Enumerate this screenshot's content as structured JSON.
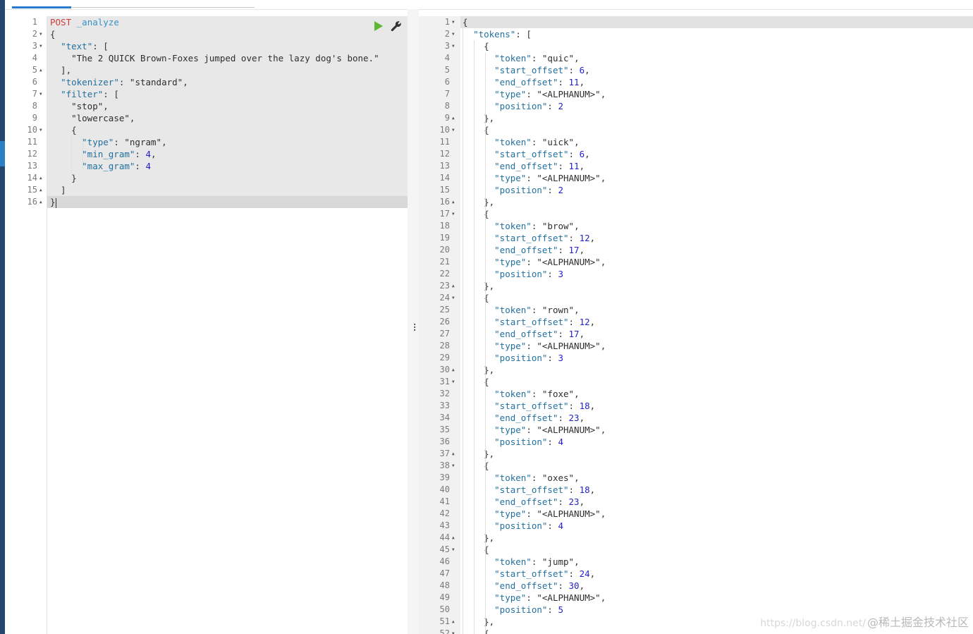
{
  "request": {
    "method": "POST",
    "path": "_analyze",
    "lines": [
      [
        [
          "p",
          "{"
        ]
      ],
      [
        [
          "p",
          "  "
        ],
        [
          "k",
          "\"text\""
        ],
        [
          "p",
          ": ["
        ]
      ],
      [
        [
          "p",
          "    "
        ],
        [
          "s",
          "\"The 2 QUICK Brown-Foxes jumped over the lazy dog's bone.\""
        ]
      ],
      [
        [
          "p",
          "  ],"
        ]
      ],
      [
        [
          "p",
          "  "
        ],
        [
          "k",
          "\"tokenizer\""
        ],
        [
          "p",
          ": "
        ],
        [
          "s",
          "\"standard\""
        ],
        [
          "p",
          ","
        ]
      ],
      [
        [
          "p",
          "  "
        ],
        [
          "k",
          "\"filter\""
        ],
        [
          "p",
          ": ["
        ]
      ],
      [
        [
          "p",
          "    "
        ],
        [
          "s",
          "\"stop\""
        ],
        [
          "p",
          ","
        ]
      ],
      [
        [
          "p",
          "    "
        ],
        [
          "s",
          "\"lowercase\""
        ],
        [
          "p",
          ","
        ]
      ],
      [
        [
          "p",
          "    {"
        ]
      ],
      [
        [
          "p",
          "      "
        ],
        [
          "k",
          "\"type\""
        ],
        [
          "p",
          ": "
        ],
        [
          "s",
          "\"ngram\""
        ],
        [
          "p",
          ","
        ]
      ],
      [
        [
          "p",
          "      "
        ],
        [
          "k",
          "\"min_gram\""
        ],
        [
          "p",
          ": "
        ],
        [
          "n",
          "4"
        ],
        [
          "p",
          ","
        ]
      ],
      [
        [
          "p",
          "      "
        ],
        [
          "k",
          "\"max_gram\""
        ],
        [
          "p",
          ": "
        ],
        [
          "n",
          "4"
        ]
      ],
      [
        [
          "p",
          "    }"
        ]
      ],
      [
        [
          "p",
          "  ]"
        ]
      ],
      [
        [
          "p",
          "}"
        ]
      ]
    ],
    "gutter": [
      {
        "n": "1",
        "fold": ""
      },
      {
        "n": "2",
        "fold": "▼"
      },
      {
        "n": "3",
        "fold": "▼"
      },
      {
        "n": "4",
        "fold": ""
      },
      {
        "n": "5",
        "fold": "▲"
      },
      {
        "n": "6",
        "fold": ""
      },
      {
        "n": "7",
        "fold": "▼"
      },
      {
        "n": "8",
        "fold": ""
      },
      {
        "n": "9",
        "fold": ""
      },
      {
        "n": "10",
        "fold": "▼"
      },
      {
        "n": "11",
        "fold": ""
      },
      {
        "n": "12",
        "fold": ""
      },
      {
        "n": "13",
        "fold": ""
      },
      {
        "n": "14",
        "fold": "▲"
      },
      {
        "n": "15",
        "fold": "▲"
      },
      {
        "n": "16",
        "fold": "▲"
      }
    ]
  },
  "toolbar": {
    "play_icon": "play-icon",
    "wrench_icon": "wrench-icon",
    "play_color": "#5fb832"
  },
  "response": {
    "tokens": [
      {
        "token": "quic",
        "start_offset": "6",
        "end_offset": "11",
        "type": "<ALPHANUM>",
        "position": "2"
      },
      {
        "token": "uick",
        "start_offset": "6",
        "end_offset": "11",
        "type": "<ALPHANUM>",
        "position": "2"
      },
      {
        "token": "brow",
        "start_offset": "12",
        "end_offset": "17",
        "type": "<ALPHANUM>",
        "position": "3"
      },
      {
        "token": "rown",
        "start_offset": "12",
        "end_offset": "17",
        "type": "<ALPHANUM>",
        "position": "3"
      },
      {
        "token": "foxe",
        "start_offset": "18",
        "end_offset": "23",
        "type": "<ALPHANUM>",
        "position": "4"
      },
      {
        "token": "oxes",
        "start_offset": "18",
        "end_offset": "23",
        "type": "<ALPHANUM>",
        "position": "4"
      },
      {
        "token": "jump",
        "start_offset": "24",
        "end_offset": "30",
        "type": "<ALPHANUM>",
        "position": "5"
      }
    ],
    "gutter_count": 52
  },
  "watermark": {
    "url": "https://blog.csdn.net/",
    "text": "@稀土掘金技术社区"
  }
}
